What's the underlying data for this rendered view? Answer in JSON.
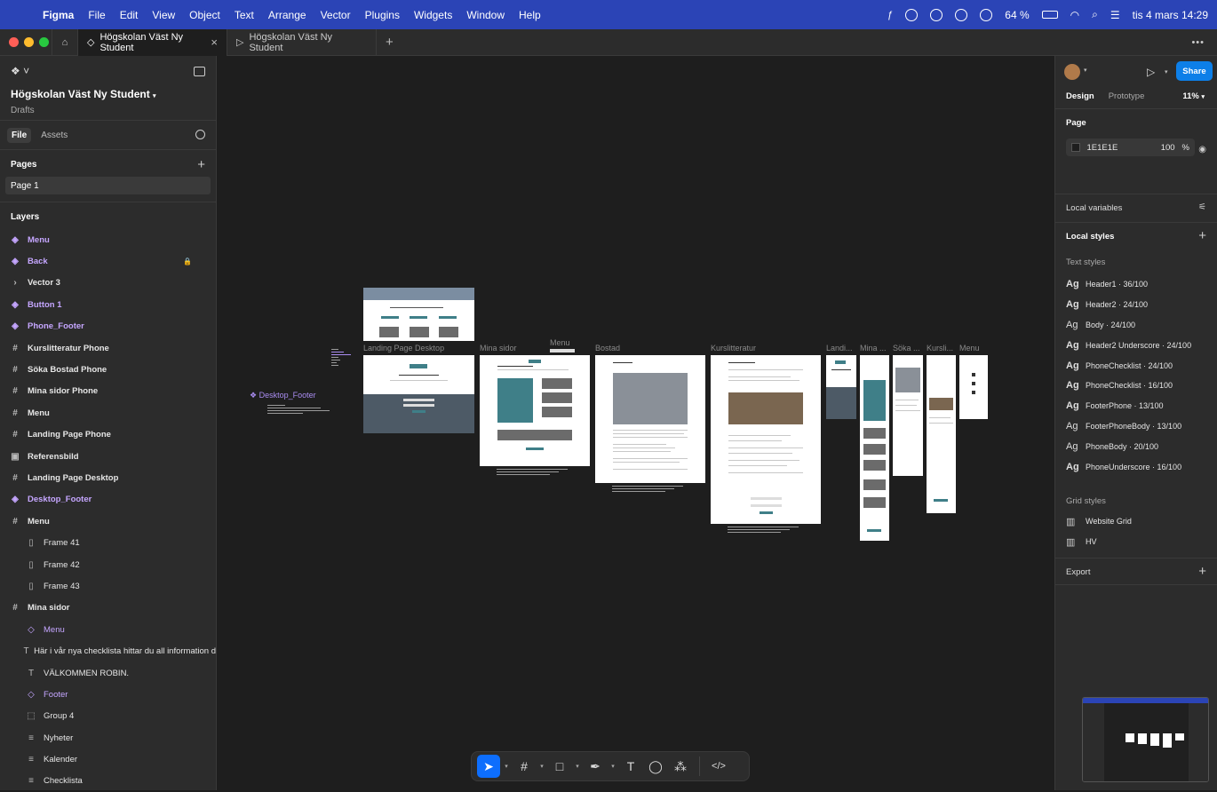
{
  "menubar": {
    "app": "Figma",
    "items": [
      "File",
      "Edit",
      "View",
      "Object",
      "Text",
      "Arrange",
      "Vector",
      "Plugins",
      "Widgets",
      "Window",
      "Help"
    ],
    "battery": "64 %",
    "clock": "tis 4 mars 14:29"
  },
  "tabs": [
    {
      "label": "Högskolan Väst Ny Student",
      "active": true
    },
    {
      "label": "Högskolan Väst Ny Student",
      "active": false
    }
  ],
  "left": {
    "file_title": "Högskolan Väst Ny Student",
    "file_sub": "Drafts",
    "tab_file": "File",
    "tab_assets": "Assets",
    "pages_label": "Pages",
    "page1": "Page 1",
    "layers_label": "Layers",
    "layers": [
      {
        "label": "Menu",
        "icon": "◈",
        "kind": "comp",
        "indent": 0
      },
      {
        "label": "Back",
        "icon": "◈",
        "kind": "comp",
        "indent": 0,
        "locked": true
      },
      {
        "label": "Vector 3",
        "icon": "›",
        "kind": "plain",
        "indent": 0
      },
      {
        "label": "Button 1",
        "icon": "◈",
        "kind": "comp",
        "indent": 0
      },
      {
        "label": "Phone_Footer",
        "icon": "◈",
        "kind": "comp",
        "indent": 0
      },
      {
        "label": "Kurslitteratur Phone",
        "icon": "#",
        "kind": "frame",
        "indent": 0
      },
      {
        "label": "Söka Bostad Phone",
        "icon": "#",
        "kind": "frame",
        "indent": 0
      },
      {
        "label": "Mina sidor Phone",
        "icon": "#",
        "kind": "frame",
        "indent": 0
      },
      {
        "label": "Menu",
        "icon": "#",
        "kind": "frame",
        "indent": 0
      },
      {
        "label": "Landing Page Phone",
        "icon": "#",
        "kind": "frame",
        "indent": 0
      },
      {
        "label": "Referensbild",
        "icon": "▣",
        "kind": "plain",
        "indent": 0
      },
      {
        "label": "Landing Page Desktop",
        "icon": "#",
        "kind": "frame",
        "indent": 0
      },
      {
        "label": "Desktop_Footer",
        "icon": "◈",
        "kind": "comp",
        "indent": 0
      },
      {
        "label": "Menu",
        "icon": "#",
        "kind": "frame",
        "indent": 0
      },
      {
        "label": "Frame 41",
        "icon": "▯",
        "kind": "plain",
        "indent": 1
      },
      {
        "label": "Frame 42",
        "icon": "▯",
        "kind": "plain",
        "indent": 1
      },
      {
        "label": "Frame 43",
        "icon": "▯",
        "kind": "plain",
        "indent": 1
      },
      {
        "label": "Mina sidor",
        "icon": "#",
        "kind": "frame",
        "indent": 0
      },
      {
        "label": "Menu",
        "icon": "◇",
        "kind": "comp",
        "indent": 1
      },
      {
        "label": "Här i vår nya checklista hittar du all information d",
        "icon": "T",
        "kind": "plain",
        "indent": 1
      },
      {
        "label": "VÄLKOMMEN ROBIN.",
        "icon": "T",
        "kind": "plain",
        "indent": 1
      },
      {
        "label": "Footer",
        "icon": "◇",
        "kind": "comp",
        "indent": 1
      },
      {
        "label": "Group 4",
        "icon": "⬚",
        "kind": "plain",
        "indent": 1
      },
      {
        "label": "Nyheter",
        "icon": "≡",
        "kind": "plain",
        "indent": 1
      },
      {
        "label": "Kalender",
        "icon": "≡",
        "kind": "plain",
        "indent": 1
      },
      {
        "label": "Checklista",
        "icon": "≡",
        "kind": "plain",
        "indent": 1
      }
    ]
  },
  "canvas": {
    "labels": {
      "desktop_footer": "Desktop_Footer",
      "landing_desktop": "Landing Page Desktop",
      "mina_sidor": "Mina sidor",
      "menu": "Menu",
      "bostad": "Bostad",
      "kurslitteratur": "Kurslitteratur",
      "landi": "Landi...",
      "mina": "Mina ...",
      "soka": "Söka ...",
      "kursli": "Kursli...",
      "menu2": "Menu"
    }
  },
  "right": {
    "share": "Share",
    "tab_design": "Design",
    "tab_prototype": "Prototype",
    "zoom": "11%",
    "page_label": "Page",
    "bg_hex": "1E1E1E",
    "opacity": "100",
    "pct": "%",
    "local_variables": "Local variables",
    "local_styles": "Local styles",
    "text_styles": "Text styles",
    "styles": [
      {
        "label": "Header1 · 36/100",
        "bold": true
      },
      {
        "label": "Header2 · 24/100",
        "bold": true
      },
      {
        "label": "Body · 24/100",
        "bold": false
      },
      {
        "label": "Header2 Underscore · 24/100",
        "bold": true
      },
      {
        "label": "PhoneChecklist · 24/100",
        "bold": true
      },
      {
        "label": "PhoneChecklist · 16/100",
        "bold": true
      },
      {
        "label": "FooterPhone · 13/100",
        "bold": true
      },
      {
        "label": "FooterPhoneBody · 13/100",
        "bold": false
      },
      {
        "label": "PhoneBody · 20/100",
        "bold": false
      },
      {
        "label": "PhoneUnderscore · 16/100",
        "bold": true
      }
    ],
    "grid_styles": "Grid styles",
    "grids": [
      "Website Grid",
      "HV"
    ],
    "export": "Export"
  },
  "colors": {
    "accent": "#0d7fe8",
    "component": "#c5a6ff",
    "menubar": "#2b44b6",
    "teal": "#3f7f88"
  }
}
